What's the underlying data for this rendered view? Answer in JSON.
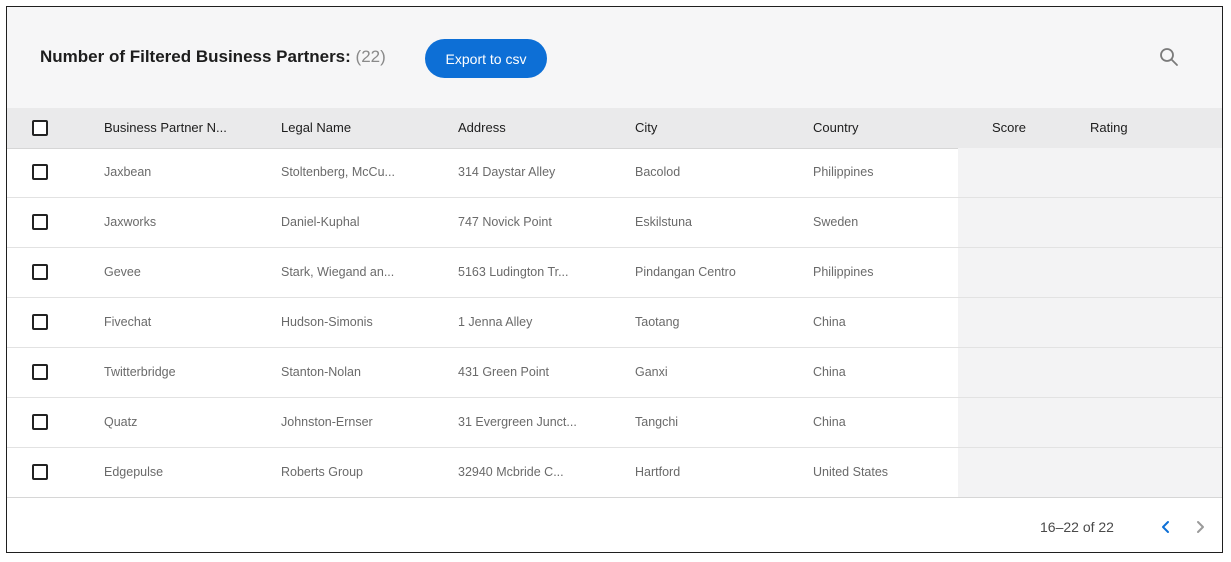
{
  "header": {
    "title_label": "Number of Filtered Business Partners:",
    "title_count": "(22)",
    "export_label": "Export to csv",
    "search_icon": "search-icon"
  },
  "table": {
    "columns": [
      "Business Partner N...",
      "Legal Name",
      "Address",
      "City",
      "Country",
      "Score",
      "Rating"
    ],
    "rows": [
      [
        "Jaxbean",
        "Stoltenberg, McCu...",
        "314 Daystar Alley",
        "Bacolod",
        "Philippines"
      ],
      [
        "Jaxworks",
        "Daniel-Kuphal",
        "747 Novick Point",
        "Eskilstuna",
        "Sweden"
      ],
      [
        "Gevee",
        "Stark, Wiegand an...",
        "5163 Ludington Tr...",
        "Pindangan Centro",
        "Philippines"
      ],
      [
        "Fivechat",
        "Hudson-Simonis",
        "1 Jenna Alley",
        "Taotang",
        "China"
      ],
      [
        "Twitterbridge",
        "Stanton-Nolan",
        "431 Green Point",
        "Ganxi",
        "China"
      ],
      [
        "Quatz",
        "Johnston-Ernser",
        "31 Evergreen Junct...",
        "Tangchi",
        "China"
      ],
      [
        "Edgepulse",
        "Roberts Group",
        "32940 Mcbride C...",
        "Hartford",
        "United States"
      ]
    ]
  },
  "pagination": {
    "range": "16–22 of 22",
    "prev_icon": "chevron-left-icon",
    "next_icon": "chevron-right-icon"
  },
  "colors": {
    "accent": "#0d6fd6",
    "header_bg": "#f6f6f7",
    "table_head_bg": "#eaeaeb",
    "shaded_column_bg": "#f3f3f4"
  }
}
